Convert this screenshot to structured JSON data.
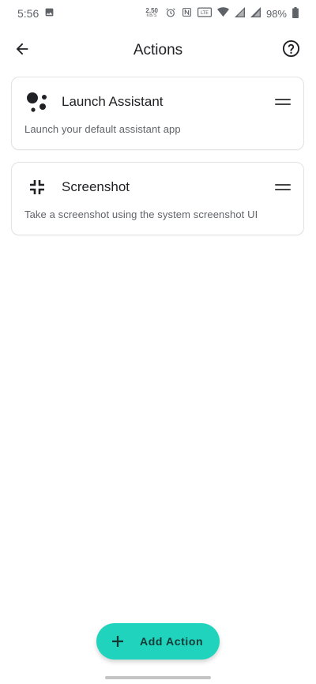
{
  "status_bar": {
    "time": "5:56",
    "net_speed": "2.50",
    "net_unit": "KB/S",
    "battery": "98%",
    "icons": [
      "image-icon",
      "alarm-icon",
      "nfc-icon",
      "volte-icon",
      "wifi-icon",
      "signal-icon",
      "signal-icon",
      "battery-icon"
    ]
  },
  "app_bar": {
    "title": "Actions",
    "back_icon": "back-arrow-icon",
    "help_icon": "help-circle-icon"
  },
  "actions": [
    {
      "title": "Launch Assistant",
      "description": "Launch your default assistant app",
      "icon": "assistant-icon"
    },
    {
      "title": "Screenshot",
      "description": "Take a screenshot using the system screenshot UI",
      "icon": "screenshot-icon"
    }
  ],
  "fab": {
    "label": "Add Action",
    "icon": "plus-icon"
  },
  "colors": {
    "accent": "#20d3bc",
    "text_primary": "#202124",
    "text_secondary": "#606368"
  }
}
